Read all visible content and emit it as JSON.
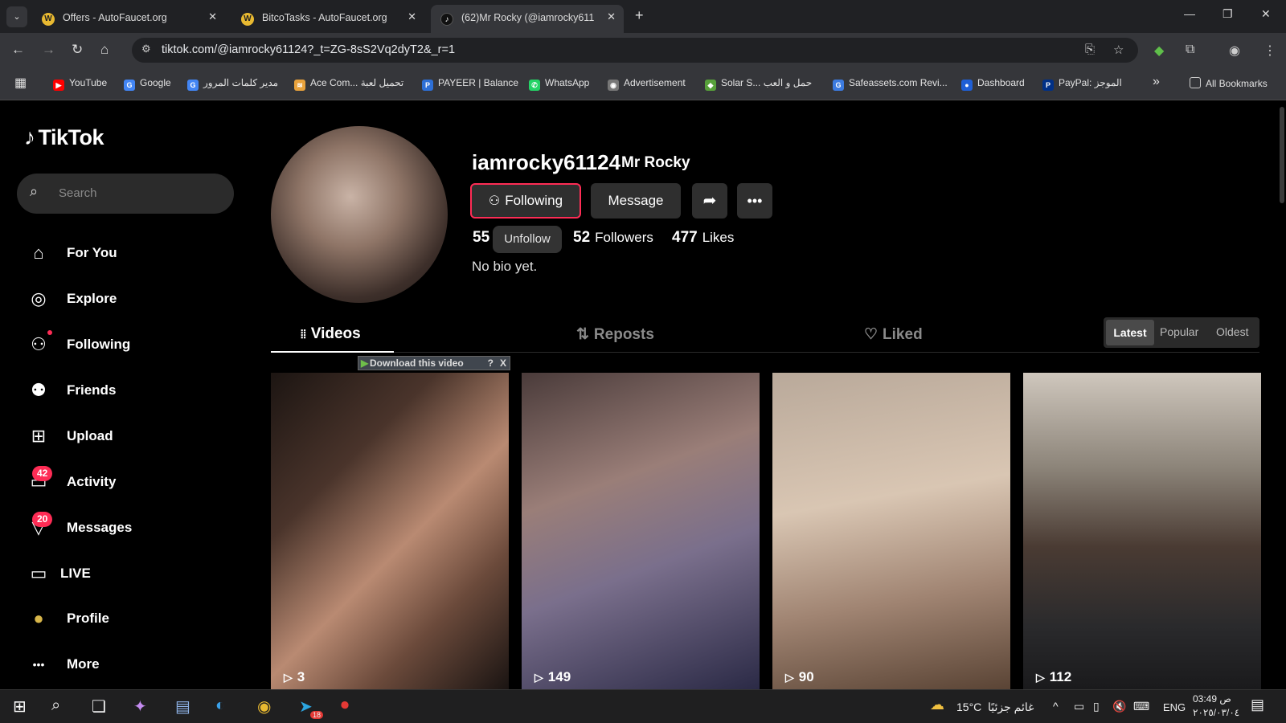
{
  "browser": {
    "tabs": [
      {
        "label": "Offers - AutoFaucet.org",
        "fav": "W"
      },
      {
        "label": "BitcoTasks - AutoFaucet.org",
        "fav": "W"
      },
      {
        "label": "(62)Mr Rocky (@iamrocky61124",
        "fav": "♪"
      }
    ],
    "url": "tiktok.com/@iamrocky61124?_t=ZG-8sS2Vq2dyT2&_r=1",
    "bookmarks": [
      {
        "label": "YouTube",
        "color": "#ff0000",
        "glyph": "▶"
      },
      {
        "label": "Google",
        "color": "#4285f4",
        "glyph": "G"
      },
      {
        "label": "مدير كلمات المرور",
        "color": "#4285f4",
        "glyph": "G"
      },
      {
        "label": "Ace Com... تحميل لعبة",
        "color": "#e8a23c",
        "glyph": "≋"
      },
      {
        "label": "PAYEER | Balance",
        "color": "#2d6fd6",
        "glyph": "P"
      },
      {
        "label": "WhatsApp",
        "color": "#25d366",
        "glyph": "✆"
      },
      {
        "label": "Advertisement",
        "color": "#777",
        "glyph": "◉"
      },
      {
        "label": "Solar S... حمل و العب",
        "color": "#57a03a",
        "glyph": "◆"
      },
      {
        "label": "Safeassets.com Revi...",
        "color": "#3c7be0",
        "glyph": "G"
      },
      {
        "label": "Dashboard",
        "color": "#1f5fd6",
        "glyph": "●"
      },
      {
        "label": "PayPal: الموجز",
        "color": "#003087",
        "glyph": "P"
      }
    ],
    "all_bookmarks": "All Bookmarks",
    "more_bookmarks": "»"
  },
  "sidebar": {
    "logo": "TikTok",
    "search_placeholder": "Search",
    "items": [
      {
        "label": "For You",
        "icon": "⌂"
      },
      {
        "label": "Explore",
        "icon": "◎"
      },
      {
        "label": "Following",
        "icon": "⚇"
      },
      {
        "label": "Friends",
        "icon": "⚉"
      },
      {
        "label": "Upload",
        "icon": "⊞"
      },
      {
        "label": "Activity",
        "icon": "▭",
        "badge": "42"
      },
      {
        "label": "Messages",
        "icon": "▽",
        "badge": "20"
      },
      {
        "label": "LIVE",
        "icon": "▭"
      },
      {
        "label": "Profile",
        "icon": "●"
      },
      {
        "label": "More",
        "icon": "•••"
      }
    ]
  },
  "profile": {
    "username": "iamrocky61124",
    "nickname": "Mr Rocky",
    "following_button": "Following",
    "message_button": "Message",
    "following_count": "55",
    "tooltip": "Unfollow",
    "followers_count": "52",
    "followers_label": "Followers",
    "likes_count": "477",
    "likes_label": "Likes",
    "bio": "No bio yet."
  },
  "content_tabs": {
    "videos": "Videos",
    "reposts": "Reposts",
    "liked": "Liked"
  },
  "sort": {
    "latest": "Latest",
    "popular": "Popular",
    "oldest": "Oldest"
  },
  "download_overlay": {
    "label": "Download this video",
    "help": "?",
    "close": "X"
  },
  "videos": [
    {
      "views": "3"
    },
    {
      "views": "149"
    },
    {
      "views": "90"
    },
    {
      "views": "112"
    }
  ],
  "taskbar": {
    "temperature": "15°C",
    "weather": "غائم جزئيًا",
    "language": "ENG",
    "time": "03:49 ص",
    "date": "٢٠٢٥/٠٣/٠٤",
    "telegram_badge": "18"
  }
}
